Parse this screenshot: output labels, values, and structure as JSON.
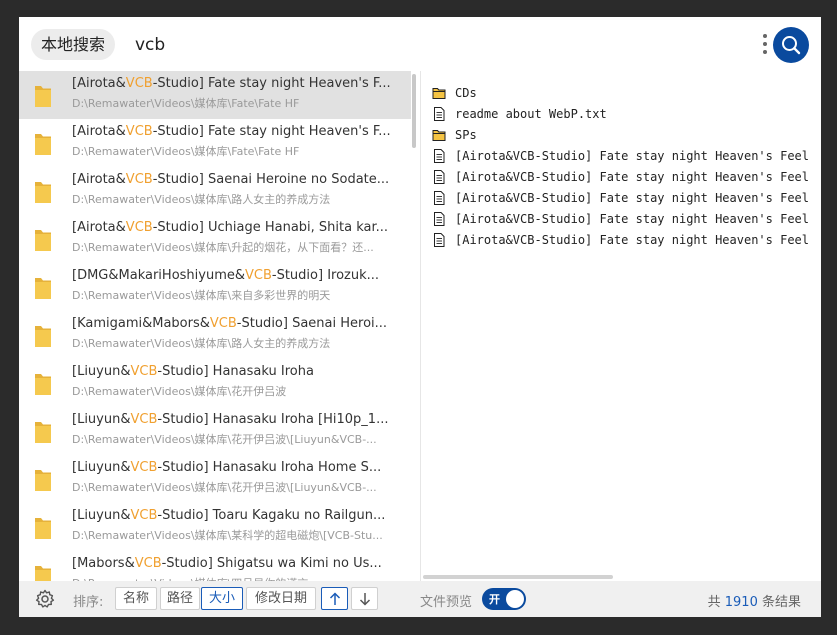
{
  "search": {
    "scope_label": "本地搜索",
    "query": "vcb"
  },
  "colors": {
    "accent": "#0a4a9e",
    "highlight": "#f0a030",
    "folder": "#f5c444"
  },
  "results": [
    {
      "pre": "[Airota&",
      "hl": "VCB",
      "post": "-Studio] Fate stay night Heaven's F...",
      "path": "D:\\Remawater\\Videos\\媒体库\\Fate\\Fate HF",
      "selected": true
    },
    {
      "pre": "[Airota&",
      "hl": "VCB",
      "post": "-Studio] Fate stay night Heaven's F...",
      "path": "D:\\Remawater\\Videos\\媒体库\\Fate\\Fate HF"
    },
    {
      "pre": "[Airota&",
      "hl": "VCB",
      "post": "-Studio] Saenai Heroine no Sodate...",
      "path": "D:\\Remawater\\Videos\\媒体库\\路人女主的养成方法"
    },
    {
      "pre": "[Airota&",
      "hl": "VCB",
      "post": "-Studio] Uchiage Hanabi, Shita kar...",
      "path": "D:\\Remawater\\Videos\\媒体库\\升起的烟花，从下面看？还..."
    },
    {
      "pre": "[DMG&MakariHoshiyume&",
      "hl": "VCB",
      "post": "-Studio] Irozuk...",
      "path": "D:\\Remawater\\Videos\\媒体库\\来自多彩世界的明天"
    },
    {
      "pre": "[Kamigami&Mabors&",
      "hl": "VCB",
      "post": "-Studio] Saenai Heroi...",
      "path": "D:\\Remawater\\Videos\\媒体库\\路人女主的养成方法"
    },
    {
      "pre": "[Liuyun&",
      "hl": "VCB",
      "post": "-Studio] Hanasaku Iroha",
      "path": "D:\\Remawater\\Videos\\媒体库\\花开伊吕波"
    },
    {
      "pre": "[Liuyun&",
      "hl": "VCB",
      "post": "-Studio] Hanasaku Iroha [Hi10p_1...",
      "path": "D:\\Remawater\\Videos\\媒体库\\花开伊吕波\\[Liuyun&VCB-..."
    },
    {
      "pre": "[Liuyun&",
      "hl": "VCB",
      "post": "-Studio] Hanasaku Iroha Home S...",
      "path": "D:\\Remawater\\Videos\\媒体库\\花开伊吕波\\[Liuyun&VCB-..."
    },
    {
      "pre": "[Liuyun&",
      "hl": "VCB",
      "post": "-Studio] Toaru Kagaku no Railgun...",
      "path": "D:\\Remawater\\Videos\\媒体库\\某科学的超电磁炮\\[VCB-Stu..."
    },
    {
      "pre": "[Mabors&",
      "hl": "VCB",
      "post": "-Studio] Shigatsu wa Kimi no Us...",
      "path": "D:\\Remawater\\Videos\\媒体库\\四月是你的谎言"
    }
  ],
  "preview": [
    {
      "type": "folder",
      "name": "CDs"
    },
    {
      "type": "file",
      "name": "readme about WebP.txt"
    },
    {
      "type": "folder",
      "name": "SPs"
    },
    {
      "type": "file",
      "name": "[Airota&VCB-Studio] Fate stay night Heaven's Feel"
    },
    {
      "type": "file",
      "name": "[Airota&VCB-Studio] Fate stay night Heaven's Feel"
    },
    {
      "type": "file",
      "name": "[Airota&VCB-Studio] Fate stay night Heaven's Feel"
    },
    {
      "type": "file",
      "name": "[Airota&VCB-Studio] Fate stay night Heaven's Feel"
    },
    {
      "type": "file",
      "name": "[Airota&VCB-Studio] Fate stay night Heaven's Feel"
    }
  ],
  "bottom": {
    "sort_label": "排序:",
    "sort_options": [
      "名称",
      "路径",
      "大小",
      "修改日期"
    ],
    "active_sort": "大小",
    "preview_label": "文件预览",
    "toggle_label": "开",
    "count_prefix": "共",
    "count_value": "1910",
    "count_suffix": "条结果"
  }
}
